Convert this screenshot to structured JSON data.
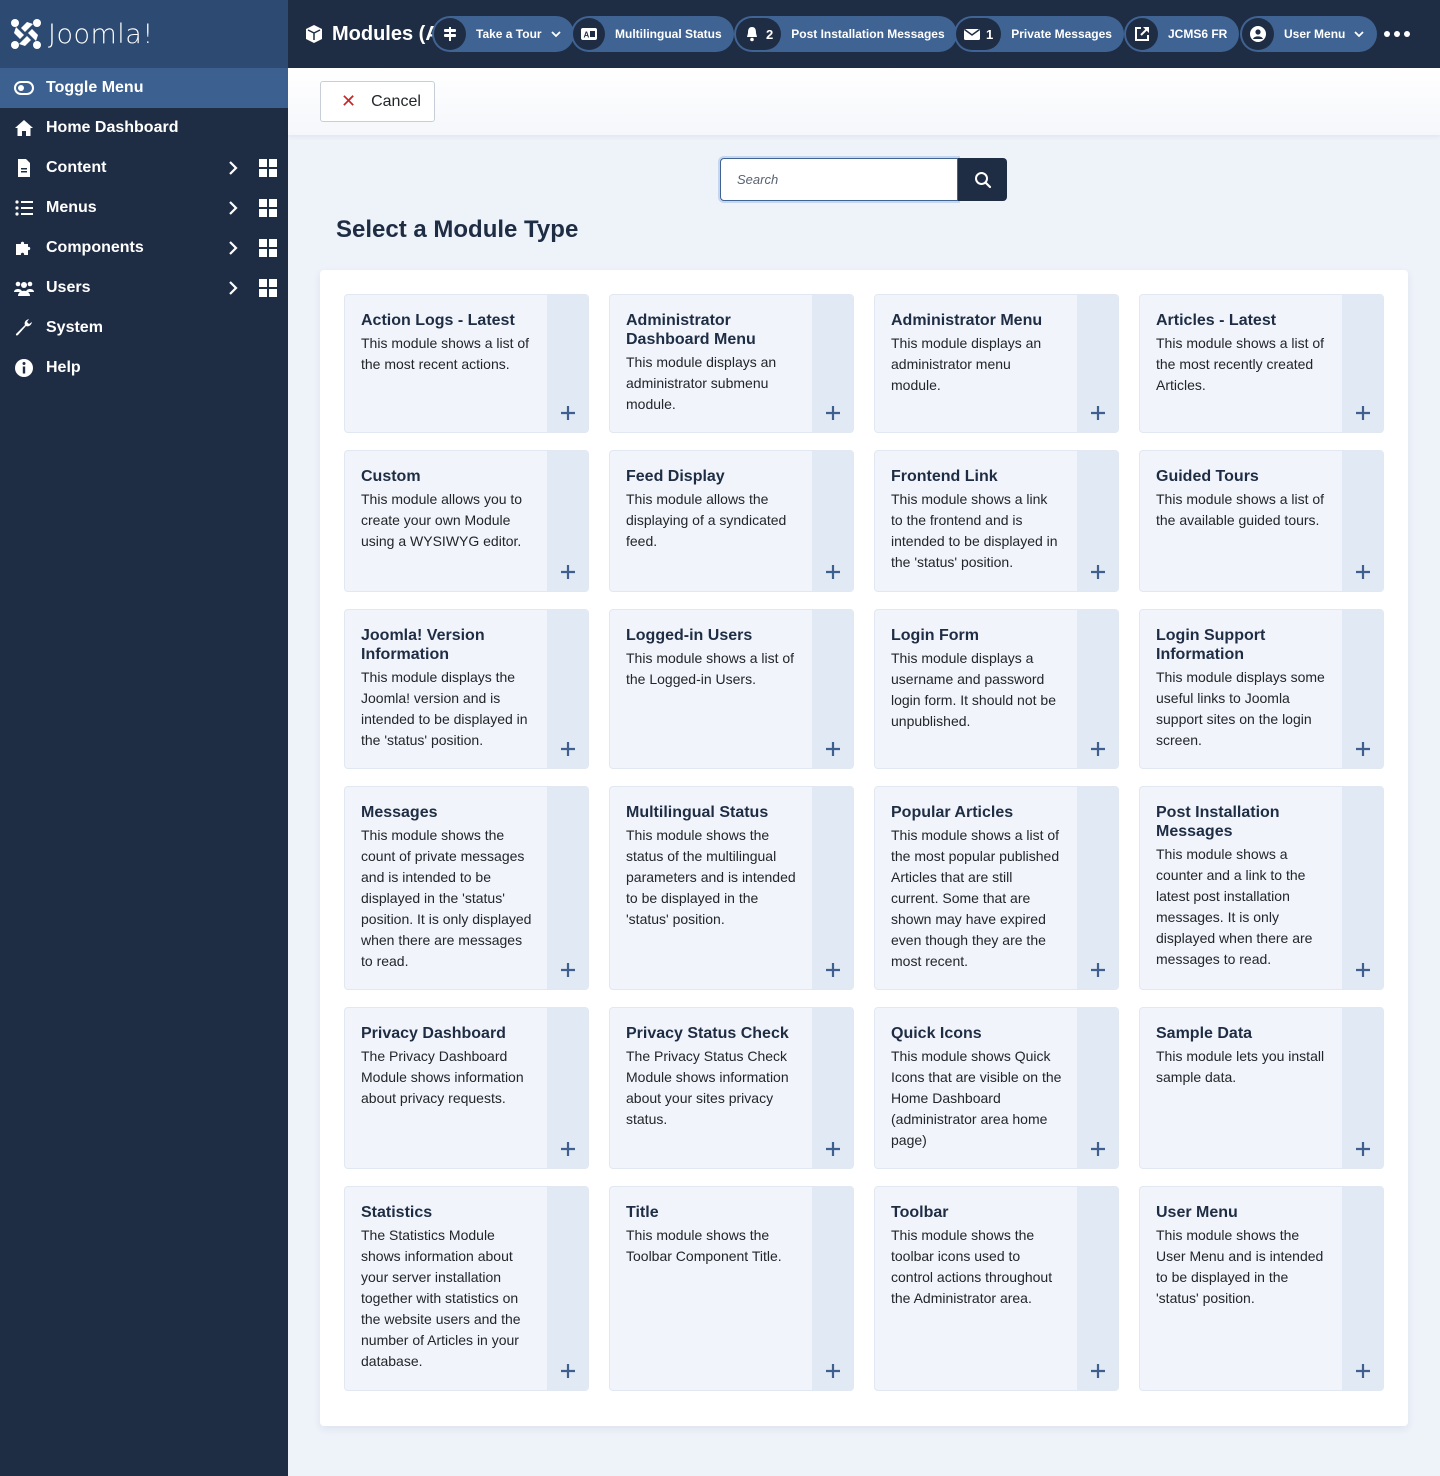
{
  "app": {
    "logo_text": "Joomla!",
    "page_title": "Modules (Administrator)"
  },
  "sidebar": {
    "toggle_label": "Toggle Menu",
    "items": [
      {
        "label": "Home Dashboard",
        "icon": "home-icon",
        "has_submenu": false
      },
      {
        "label": "Content",
        "icon": "file-icon",
        "has_submenu": true
      },
      {
        "label": "Menus",
        "icon": "list-icon",
        "has_submenu": true
      },
      {
        "label": "Components",
        "icon": "puzzle-icon",
        "has_submenu": true
      },
      {
        "label": "Users",
        "icon": "users-icon",
        "has_submenu": true
      },
      {
        "label": "System",
        "icon": "wrench-icon",
        "has_submenu": false
      },
      {
        "label": "Help",
        "icon": "info-icon",
        "has_submenu": false
      }
    ]
  },
  "header": {
    "pills": {
      "tour": {
        "label": "Take a Tour",
        "icon": "signpost-icon"
      },
      "multilingual": {
        "label": "Multilingual Status",
        "icon": "language-icon"
      },
      "post_install": {
        "label": "Post Installation Messages",
        "count": "2",
        "icon": "bell-icon"
      },
      "private_messages": {
        "label": "Private Messages",
        "count": "1",
        "icon": "envelope-icon"
      },
      "site": {
        "label": "JCMS6 FR",
        "icon": "external-link-icon"
      },
      "user_menu": {
        "label": "User Menu",
        "icon": "user-circle-icon"
      }
    }
  },
  "toolbar": {
    "cancel_label": "Cancel"
  },
  "search": {
    "placeholder": "Search",
    "value": ""
  },
  "main": {
    "heading": "Select a Module Type",
    "modules": [
      {
        "title": "Action Logs - Latest",
        "description": "This module shows a list of the most recent actions."
      },
      {
        "title": "Administrator Dashboard Menu",
        "description": "This module displays an administrator submenu module."
      },
      {
        "title": "Administrator Menu",
        "description": "This module displays an administrator menu module."
      },
      {
        "title": "Articles - Latest",
        "description": "This module shows a list of the most recently created Articles."
      },
      {
        "title": "Custom",
        "description": "This module allows you to create your own Module using a WYSIWYG editor."
      },
      {
        "title": "Feed Display",
        "description": "This module allows the displaying of a syndicated feed."
      },
      {
        "title": "Frontend Link",
        "description": "This module shows a link to the frontend and is intended to be displayed in the 'status' position."
      },
      {
        "title": "Guided Tours",
        "description": "This module shows a list of the available guided tours."
      },
      {
        "title": "Joomla! Version Information",
        "description": "This module displays the Joomla! version and is intended to be displayed in the 'status' position."
      },
      {
        "title": "Logged-in Users",
        "description": "This module shows a list of the Logged-in Users."
      },
      {
        "title": "Login Form",
        "description": "This module displays a username and password login form. It should not be unpublished."
      },
      {
        "title": "Login Support Information",
        "description": "This module displays some useful links to Joomla support sites on the login screen."
      },
      {
        "title": "Messages",
        "description": "This module shows the count of private messages and is intended to be displayed in the 'status' position. It is only displayed when there are messages to read."
      },
      {
        "title": "Multilingual Status",
        "description": "This module shows the status of the multilingual parameters and is intended to be displayed in the 'status' position."
      },
      {
        "title": "Popular Articles",
        "description": "This module shows a list of the most popular published Articles that are still current. Some that are shown may have expired even though they are the most recent."
      },
      {
        "title": "Post Installation Messages",
        "description": "This module shows a counter and a link to the latest post installation messages. It is only displayed when there are messages to read."
      },
      {
        "title": "Privacy Dashboard",
        "description": "The Privacy Dashboard Module shows information about privacy requests."
      },
      {
        "title": "Privacy Status Check",
        "description": "The Privacy Status Check Module shows information about your sites privacy status."
      },
      {
        "title": "Quick Icons",
        "description": "This module shows Quick Icons that are visible on the Home Dashboard (administrator area home page)"
      },
      {
        "title": "Sample Data",
        "description": "This module lets you install sample data."
      },
      {
        "title": "Statistics",
        "description": "The Statistics Module shows information about your server installation together with statistics on the website users and the number of Articles in your database."
      },
      {
        "title": "Title",
        "description": "This module shows the Toolbar Component Title."
      },
      {
        "title": "Toolbar",
        "description": "This module shows the toolbar icons used to control actions throughout the Administrator area."
      },
      {
        "title": "User Menu",
        "description": "This module shows the User Menu and is intended to be displayed in the 'status' position."
      }
    ]
  },
  "colors": {
    "sidebar_bg": "#1f2d44",
    "logo_bar_bg": "#2d4a72",
    "toggle_bg": "#3c6191",
    "pill_bg": "#3f6393",
    "card_bg": "#f1f5fb",
    "card_side_bg": "#e1e9f4",
    "cancel_icon": "#c52827"
  }
}
